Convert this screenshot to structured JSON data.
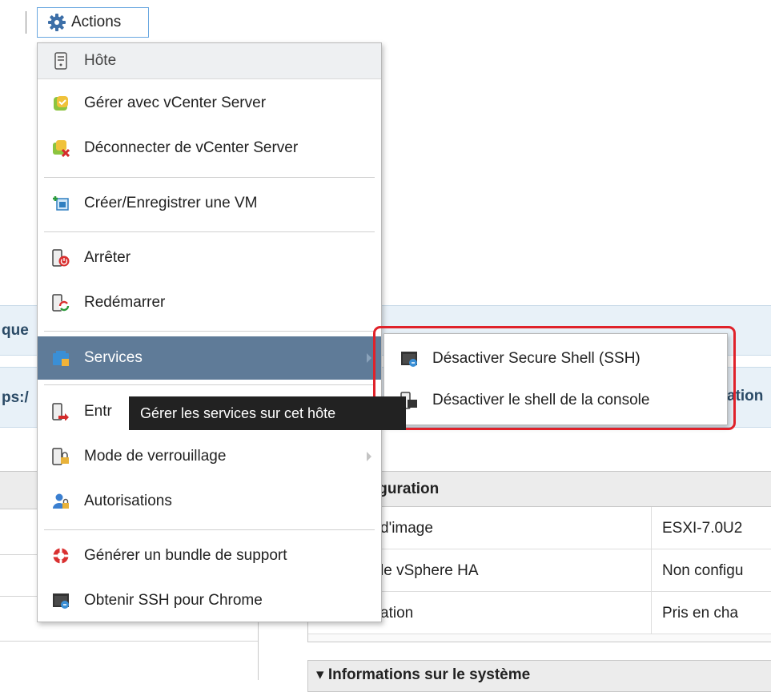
{
  "toolbar": {
    "actions_label": "Actions"
  },
  "menu": {
    "header": "Hôte",
    "items": {
      "manage_vcenter": "Gérer avec vCenter Server",
      "disconnect_vcenter": "Déconnecter de vCenter Server",
      "create_vm": "Créer/Enregistrer une VM",
      "shutdown": "Arrêter",
      "reboot": "Redémarrer",
      "services": "Services",
      "maintenance": "Entr",
      "lockdown": "Mode de verrouillage",
      "permissions": "Autorisations",
      "support_bundle": "Générer un bundle de support",
      "ssh_chrome": "Obtenir SSH pour Chrome"
    }
  },
  "submenu": {
    "disable_ssh": "Désactiver Secure Shell (SSH)",
    "disable_console_shell": "Désactiver le shell de la console"
  },
  "tooltip": "Gérer les services sur cet hôte",
  "background": {
    "band1_text": "que",
    "band2_left_text": "ps:/",
    "band2_right_text": "ation",
    "configuration": {
      "title": "iguration",
      "rows": [
        {
          "label": "d'image",
          "value": "ESXI-7.0U2"
        },
        {
          "label": "le vSphere HA",
          "value": "Non configu"
        },
        {
          "label": "ation",
          "value": "Pris en cha"
        }
      ]
    },
    "system_info_title": "▾ Informations sur le système"
  },
  "colors": {
    "menu_active_bg": "#5f7b98",
    "highlight_border": "#e0222a",
    "tooltip_bg": "#222222",
    "band_bg": "#e8f1f8",
    "button_border": "#69a7e0"
  }
}
